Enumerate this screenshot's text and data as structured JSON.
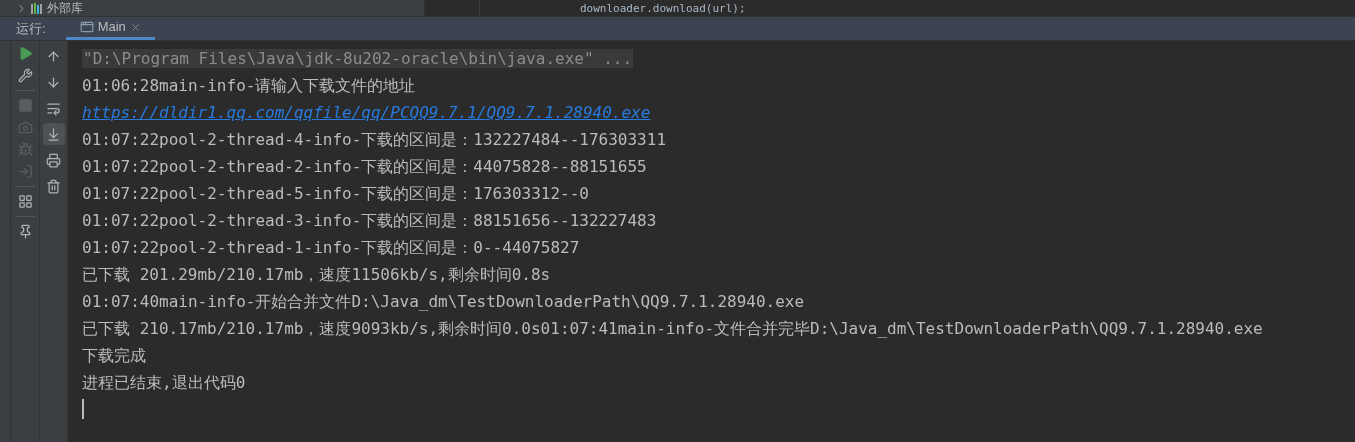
{
  "project_tree": {
    "item": "外部库"
  },
  "editor": {
    "code_line": "downloader.download(url);"
  },
  "run_panel": {
    "label": "运行:",
    "tabs": [
      {
        "label": "Main",
        "selected": true
      }
    ]
  },
  "left_toolbar": [
    {
      "kind": "run",
      "disabled": false
    },
    {
      "kind": "wrench",
      "disabled": false
    },
    {
      "kind": "sep"
    },
    {
      "kind": "stop",
      "disabled": true
    },
    {
      "kind": "camera",
      "disabled": true
    },
    {
      "kind": "bug",
      "disabled": true
    },
    {
      "kind": "login",
      "disabled": true
    },
    {
      "kind": "sep"
    },
    {
      "kind": "layout",
      "disabled": false
    },
    {
      "kind": "sep"
    },
    {
      "kind": "pin",
      "disabled": false
    }
  ],
  "right_toolbar": [
    {
      "kind": "up",
      "selected": false
    },
    {
      "kind": "down",
      "selected": false
    },
    {
      "kind": "wrap",
      "selected": false
    },
    {
      "kind": "scroll",
      "selected": true
    },
    {
      "kind": "print",
      "selected": false
    },
    {
      "kind": "trash",
      "selected": false
    }
  ],
  "console": [
    {
      "kind": "command",
      "text": "\"D:\\Program Files\\Java\\jdk-8u202-oracle\\bin\\java.exe\" ..."
    },
    {
      "kind": "output",
      "text": "01:06:28main-info-请输入下载文件的地址"
    },
    {
      "kind": "link",
      "text": "https://dldir1.qq.com/qqfile/qq/PCQQ9.7.1/QQ9.7.1.28940.exe"
    },
    {
      "kind": "output",
      "text": "01:07:22pool-2-thread-4-info-下载的区间是：132227484--176303311"
    },
    {
      "kind": "output",
      "text": "01:07:22pool-2-thread-2-info-下载的区间是：44075828--88151655"
    },
    {
      "kind": "output",
      "text": "01:07:22pool-2-thread-5-info-下载的区间是：176303312--0"
    },
    {
      "kind": "output",
      "text": "01:07:22pool-2-thread-3-info-下载的区间是：88151656--132227483"
    },
    {
      "kind": "output",
      "text": "01:07:22pool-2-thread-1-info-下载的区间是：0--44075827"
    },
    {
      "kind": "output",
      "text": "已下载 201.29mb/210.17mb，速度11506kb/s,剩余时间0.8s"
    },
    {
      "kind": "output",
      "text": "01:07:40main-info-开始合并文件D:\\Java_dm\\TestDownloaderPath\\QQ9.7.1.28940.exe"
    },
    {
      "kind": "output",
      "text": "已下载 210.17mb/210.17mb，速度9093kb/s,剩余时间0.0s01:07:41main-info-文件合并完毕D:\\Java_dm\\TestDownloaderPath\\QQ9.7.1.28940.exe"
    },
    {
      "kind": "output",
      "text": "下载完成"
    },
    {
      "kind": "output",
      "text": "进程已结束,退出代码0"
    }
  ]
}
